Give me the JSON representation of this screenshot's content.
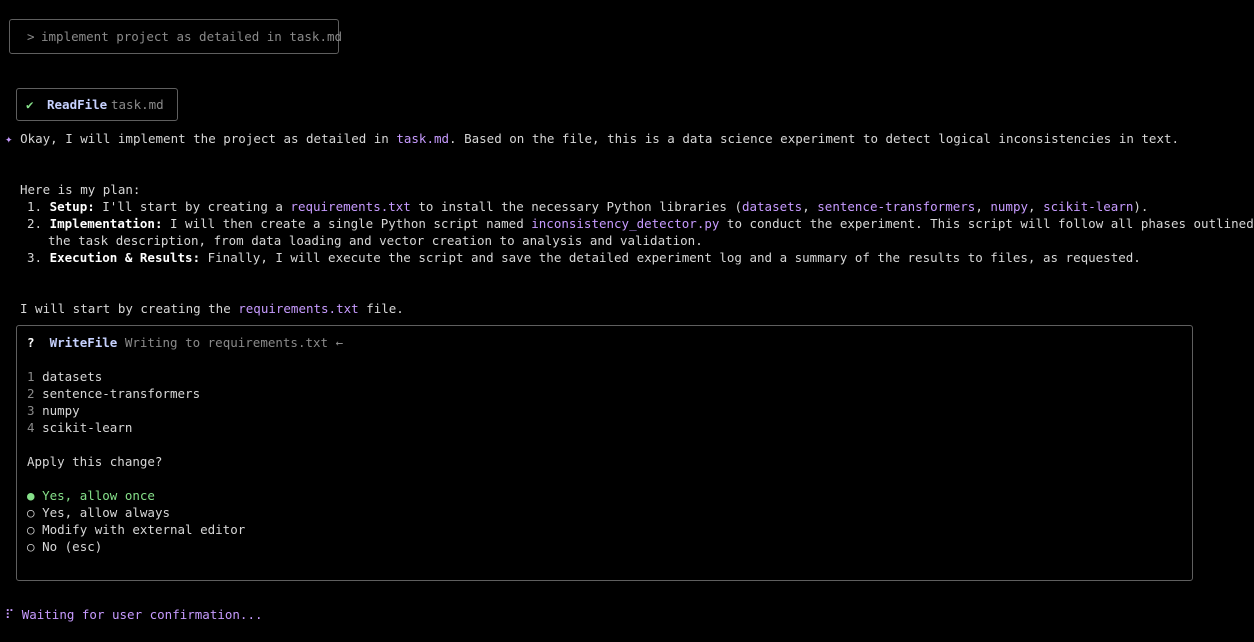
{
  "prompt": {
    "prefix": ">",
    "text": "implement project as detailed in task.md"
  },
  "read_file": {
    "check": "✔",
    "tool": "ReadFile",
    "arg": "task.md"
  },
  "intro": {
    "bullet": "✦",
    "part1": "Okay, I will implement the project as detailed in ",
    "file": "task.md",
    "part2": ". Based on the file, this is a data science experiment to detect logical inconsistencies in text."
  },
  "plan": {
    "heading": "Here is my plan:",
    "item1": {
      "num": "1.",
      "label": "Setup:",
      "t1": " I'll start by creating a ",
      "file": "requirements.txt",
      "t2": " to install the necessary Python libraries (",
      "lib1": "datasets",
      "sep1": ", ",
      "lib2": "sentence-transformers",
      "sep2": ", ",
      "lib3": "numpy",
      "sep3": ", ",
      "lib4": "scikit-learn",
      "t3": ")."
    },
    "item2": {
      "num": "2.",
      "label": "Implementation:",
      "t1": " I will then create a single Python script named ",
      "file": "inconsistency_detector.py",
      "t2": " to conduct the experiment. This script will follow all phases outlined in",
      "cont": "the task description, from data loading and vector creation to analysis and validation."
    },
    "item3": {
      "num": "3.",
      "label": "Execution & Results:",
      "t1": " Finally, I will execute the script and save the detailed experiment log and a summary of the results to files, as requested."
    }
  },
  "start": {
    "t1": "I will start by creating the ",
    "file": "requirements.txt",
    "t2": " file."
  },
  "write_file": {
    "marker": "?",
    "tool": "WriteFile",
    "desc": "Writing to requirements.txt",
    "arrow": "←",
    "lines": [
      {
        "n": "1",
        "text": "datasets"
      },
      {
        "n": "2",
        "text": "sentence-transformers"
      },
      {
        "n": "3",
        "text": "numpy"
      },
      {
        "n": "4",
        "text": "scikit-learn"
      }
    ],
    "question": "Apply this change?",
    "options": [
      {
        "mark": "●",
        "label": "Yes, allow once"
      },
      {
        "mark": "○",
        "label": "Yes, allow always"
      },
      {
        "mark": "○",
        "label": "Modify with external editor"
      },
      {
        "mark": "○",
        "label": "No (esc)"
      }
    ]
  },
  "status": {
    "spinner": "⠏",
    "text": "Waiting for user confirmation..."
  }
}
